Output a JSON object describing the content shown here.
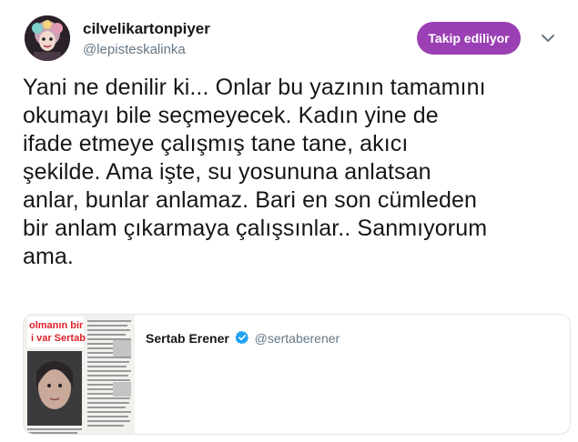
{
  "author": {
    "display_name": "cilvelikartonpiyer",
    "screen_name": "@lepisteskalinka"
  },
  "follow_button": {
    "label": "Takip ediliyor"
  },
  "tweet": {
    "lines": [
      "Yani ne denilir ki... Onlar bu yazının tamamını",
      "okumayı bile seçmeyecek. Kadın yine de",
      "ifade etmeye çalışmış tane tane, akıcı",
      "şekilde. Ama işte, su yosununa anlatsan",
      "anlar, bunlar anlamaz. Bari en son cümleden",
      "bir anlam çıkarmaya çalışsınlar.. Sanmıyorum",
      "ama."
    ]
  },
  "quoted_tweet": {
    "author_name": "Sertab Erener",
    "author_handle": "@sertaberener",
    "verified": true,
    "media_headline": [
      "olmanın bir",
      "i var Sertab"
    ]
  },
  "colors": {
    "follow_button_bg": "#9b3fb5",
    "verified_badge": "#1da1f2",
    "secondary_text": "#657786",
    "border": "#e1e8ed",
    "headline_red": "#e0202a"
  },
  "icons": {
    "caret": "chevron-down-icon",
    "verified": "verified-badge-icon"
  }
}
